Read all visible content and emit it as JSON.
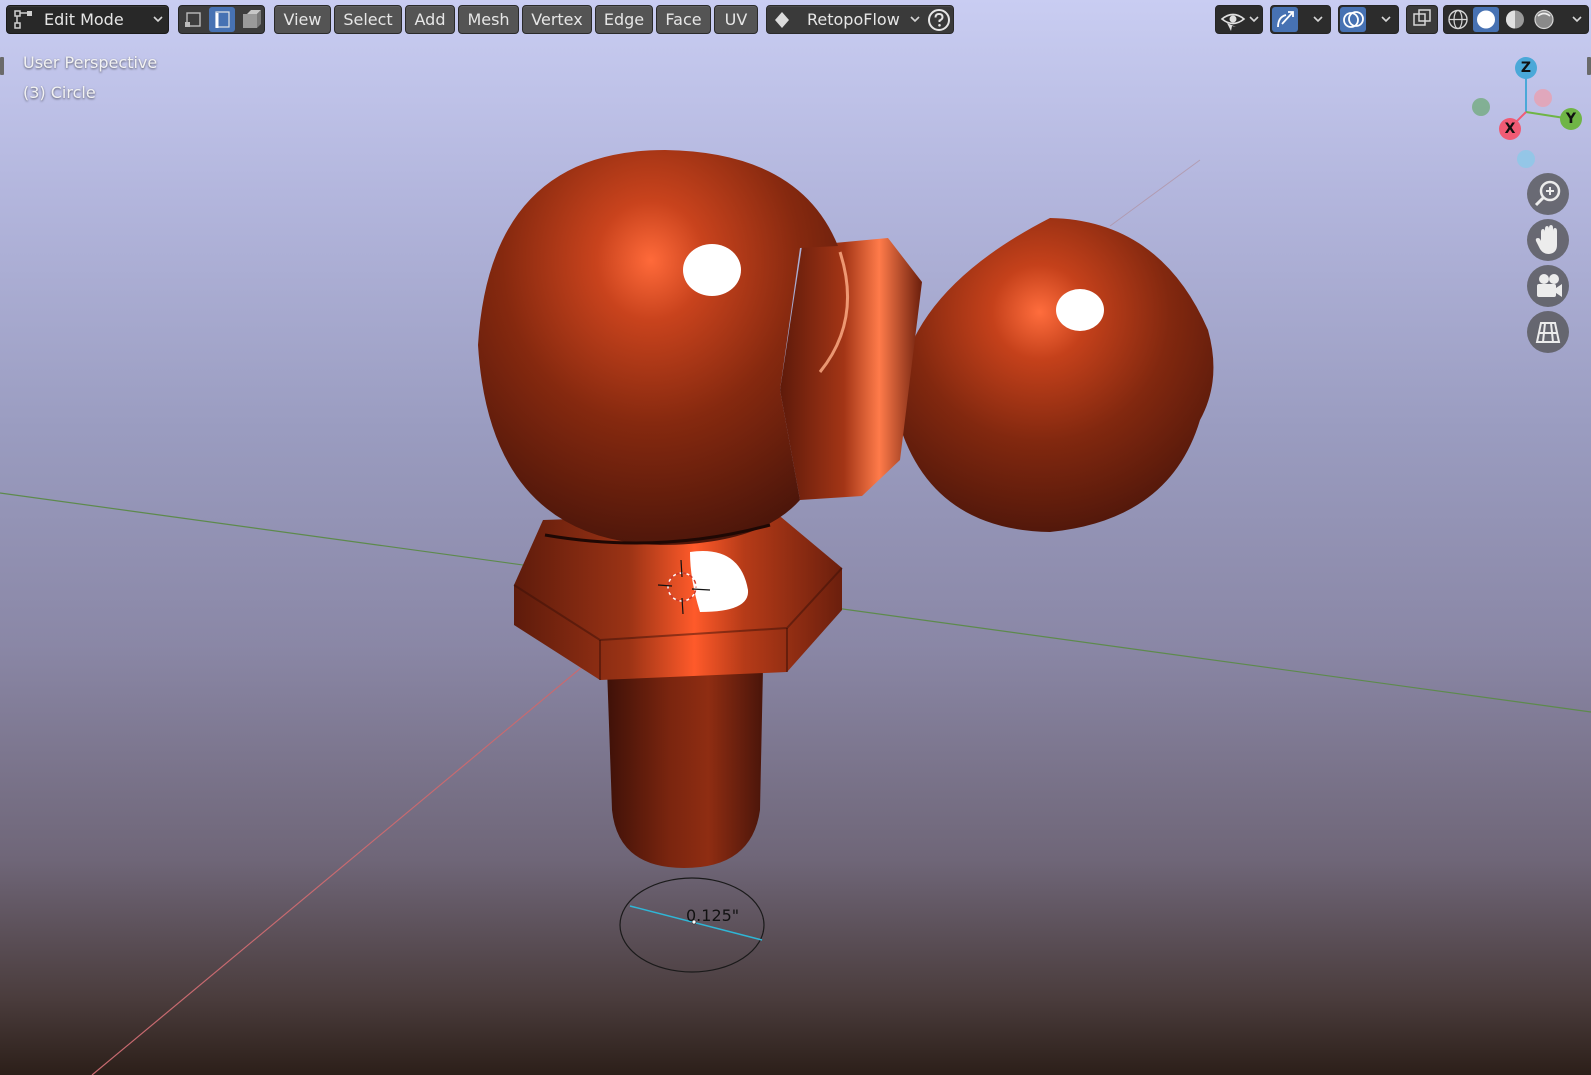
{
  "header": {
    "mode_label": "Edit Mode",
    "menus": [
      "View",
      "Select",
      "Add",
      "Mesh",
      "Vertex",
      "Edge",
      "Face",
      "UV"
    ],
    "addon_label": "RetopoFlow"
  },
  "overlay": {
    "view_name": "User Perspective",
    "object_info": "(3) Circle"
  },
  "gizmo": {
    "x_label": "X",
    "y_label": "Y",
    "z_label": "Z"
  },
  "brush": {
    "size_label": "0.125\""
  },
  "colors": {
    "accent": "#4772b3",
    "axis_x": "#f05b74",
    "axis_y": "#6fb546",
    "axis_z": "#4aa8d8",
    "mesh": "#8a2d12"
  },
  "icons": {
    "mode": "edit-mode-icon",
    "select_vertex": "vertex-select-icon",
    "select_edge": "edge-select-icon",
    "select_face": "face-select-icon",
    "retopoflow": "retopoflow-icon",
    "help": "help-icon",
    "visibility": "visibility-icon",
    "gizmo": "gizmo-icon",
    "overlay": "overlay-icon",
    "xray": "xray-icon",
    "wire": "wireframe-shading-icon",
    "solid": "solid-shading-icon",
    "material": "material-shading-icon",
    "rendered": "rendered-shading-icon",
    "zoom": "zoom-icon",
    "pan": "pan-hand-icon",
    "camera": "camera-icon",
    "grid": "ortho-grid-icon"
  }
}
